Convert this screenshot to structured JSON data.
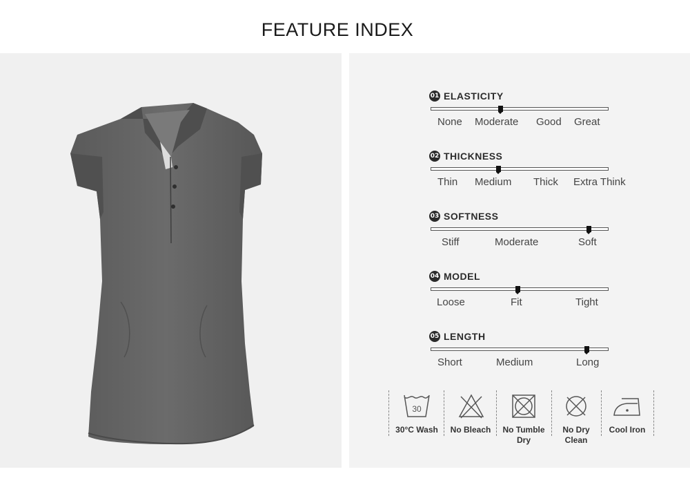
{
  "title": "FEATURE INDEX",
  "features": [
    {
      "num": "01",
      "name": "ELASTICITY",
      "labels": [
        "None",
        "Moderate",
        "Good",
        "Great"
      ],
      "level": 0.39
    },
    {
      "num": "02",
      "name": "THICKNESS",
      "labels": [
        "Thin",
        "Medium",
        "Thick",
        "Extra Think"
      ],
      "level": 0.38
    },
    {
      "num": "03",
      "name": "SOFTNESS",
      "labels": [
        "Stiff",
        "Moderate",
        "Soft"
      ],
      "level": 0.89
    },
    {
      "num": "04",
      "name": "MODEL",
      "labels": [
        "Loose",
        "Fit",
        "Tight"
      ],
      "level": 0.49
    },
    {
      "num": "05",
      "name": "LENGTH",
      "labels": [
        "Short",
        "Medium",
        "Long"
      ],
      "level": 0.88
    }
  ],
  "care": [
    {
      "icon": "wash-30-icon",
      "label_line1": "30°C Wash",
      "label_line2": "",
      "tub_number": "30"
    },
    {
      "icon": "no-bleach-icon",
      "label_line1": "No Bleach",
      "label_line2": ""
    },
    {
      "icon": "no-tumble-dry-icon",
      "label_line1": "No Tumble",
      "label_line2": "Dry"
    },
    {
      "icon": "no-dry-clean-icon",
      "label_line1": "No Dry",
      "label_line2": "Clean"
    },
    {
      "icon": "cool-iron-icon",
      "label_line1": "Cool Iron",
      "label_line2": ""
    }
  ]
}
